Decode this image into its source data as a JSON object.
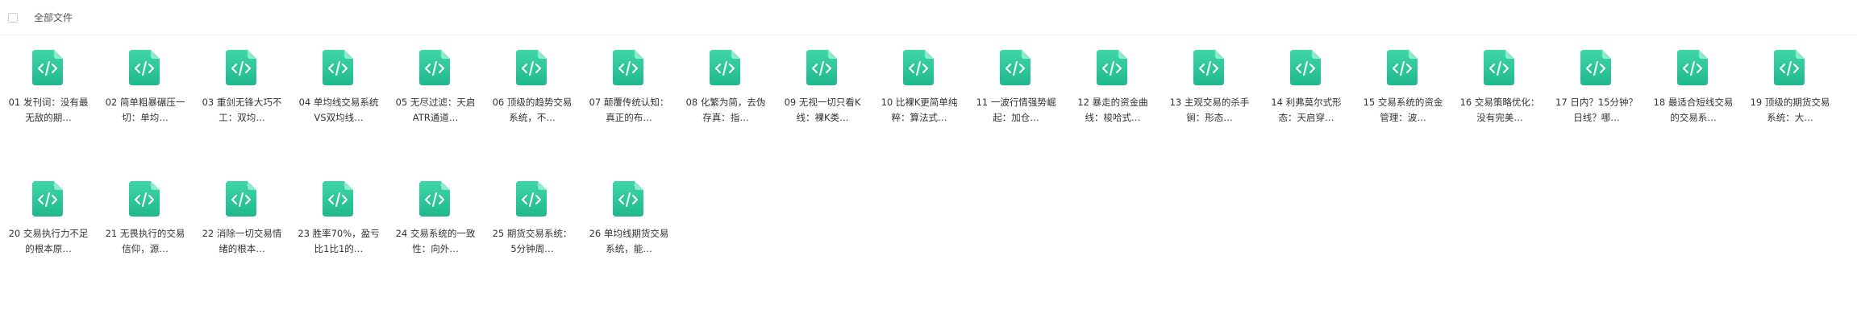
{
  "header": {
    "select_all_label": "全部文件"
  },
  "icon": {
    "name": "code-file-icon",
    "color_top": "#3ed6a7",
    "color_bottom": "#21b88d",
    "fold_color": "#8de9cc"
  },
  "files": [
    {
      "name": "01 发刊词：没有最无敌的期…"
    },
    {
      "name": "02 简单粗暴碾压一切：单均…"
    },
    {
      "name": "03 重剑无锋大巧不工：双均…"
    },
    {
      "name": "04 单均线交易系统VS双均线…"
    },
    {
      "name": "05 无尽过滤：天启ATR通道…"
    },
    {
      "name": "06 顶级的趋势交易系统，不…"
    },
    {
      "name": "07 颠覆传统认知：真正的布…"
    },
    {
      "name": "08 化繁为简，去伪存真：指…"
    },
    {
      "name": "09 无视一切只看K线：裸K类…"
    },
    {
      "name": "10 比裸K更简单纯粹：算法式…"
    },
    {
      "name": "11 一波行情强势崛起：加仓…"
    },
    {
      "name": "12 暴走的资金曲线：梭哈式…"
    },
    {
      "name": "13 主观交易的杀手锏：形态…"
    },
    {
      "name": "14 利弗莫尔式形态：天启穿…"
    },
    {
      "name": "15 交易系统的资金管理：波…"
    },
    {
      "name": "16 交易策略优化：没有完美…"
    },
    {
      "name": "17 日内？15分钟？日线？哪…"
    },
    {
      "name": "18 最适合短线交易的交易系…"
    },
    {
      "name": "19 顶级的期货交易系统：大…"
    },
    {
      "name": "20 交易执行力不足的根本原…"
    },
    {
      "name": "21 无畏执行的交易信仰，源…"
    },
    {
      "name": "22 消除一切交易情绪的根本…"
    },
    {
      "name": "23 胜率70%，盈亏比1比1的…"
    },
    {
      "name": "24 交易系统的一致性：向外…"
    },
    {
      "name": "25 期货交易系统：5分钟周…"
    },
    {
      "name": "26 单均线期货交易系统，能…"
    }
  ]
}
